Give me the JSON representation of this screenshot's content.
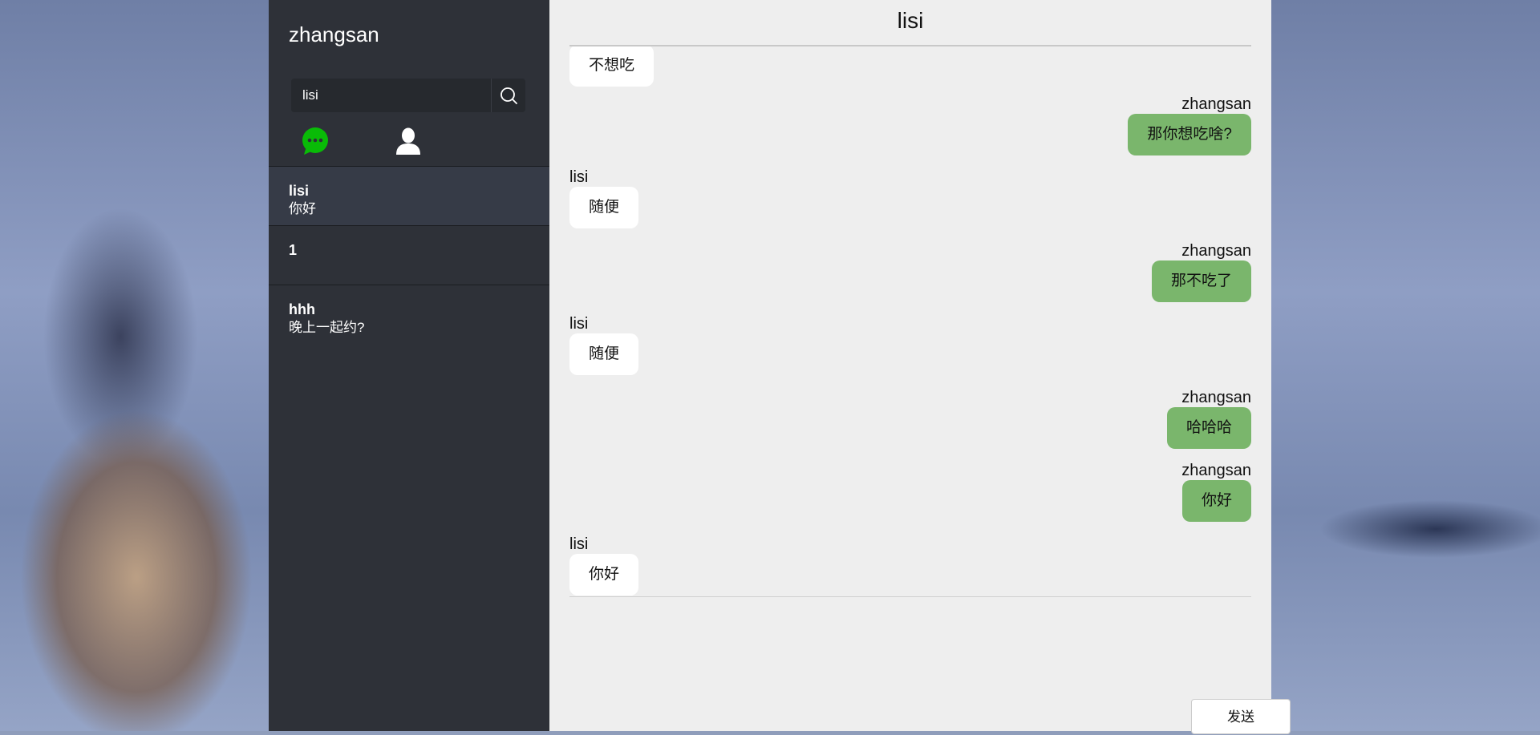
{
  "sidebar": {
    "user_name": "zhangsan",
    "search": {
      "value": "lisi",
      "placeholder": ""
    },
    "tabs": [
      {
        "icon": "chat-bubble-icon",
        "color": "#09bb07"
      },
      {
        "icon": "user-icon",
        "color": "#ffffff"
      }
    ],
    "contacts": [
      {
        "name": "lisi",
        "last_message": "你好",
        "active": true
      },
      {
        "name": "1",
        "last_message": ""
      },
      {
        "name": "hhh",
        "last_message": "晚上一起约?"
      }
    ]
  },
  "chat": {
    "title": "lisi",
    "messages": [
      {
        "side": "left",
        "sender": "",
        "text": "不想吃"
      },
      {
        "side": "right",
        "sender": "zhangsan",
        "text": "那你想吃啥?"
      },
      {
        "side": "left",
        "sender": "lisi",
        "text": "随便"
      },
      {
        "side": "right",
        "sender": "zhangsan",
        "text": "那不吃了"
      },
      {
        "side": "left",
        "sender": "lisi",
        "text": "随便"
      },
      {
        "side": "right",
        "sender": "zhangsan",
        "text": "哈哈哈"
      },
      {
        "side": "right",
        "sender": "zhangsan",
        "text": "你好"
      },
      {
        "side": "left",
        "sender": "lisi",
        "text": "你好"
      }
    ],
    "send_label": "发送"
  },
  "colors": {
    "sidebar_bg": "#2e3138",
    "chat_bg": "#eeeeee",
    "own_bubble": "#7ab66c",
    "other_bubble": "#ffffff"
  }
}
